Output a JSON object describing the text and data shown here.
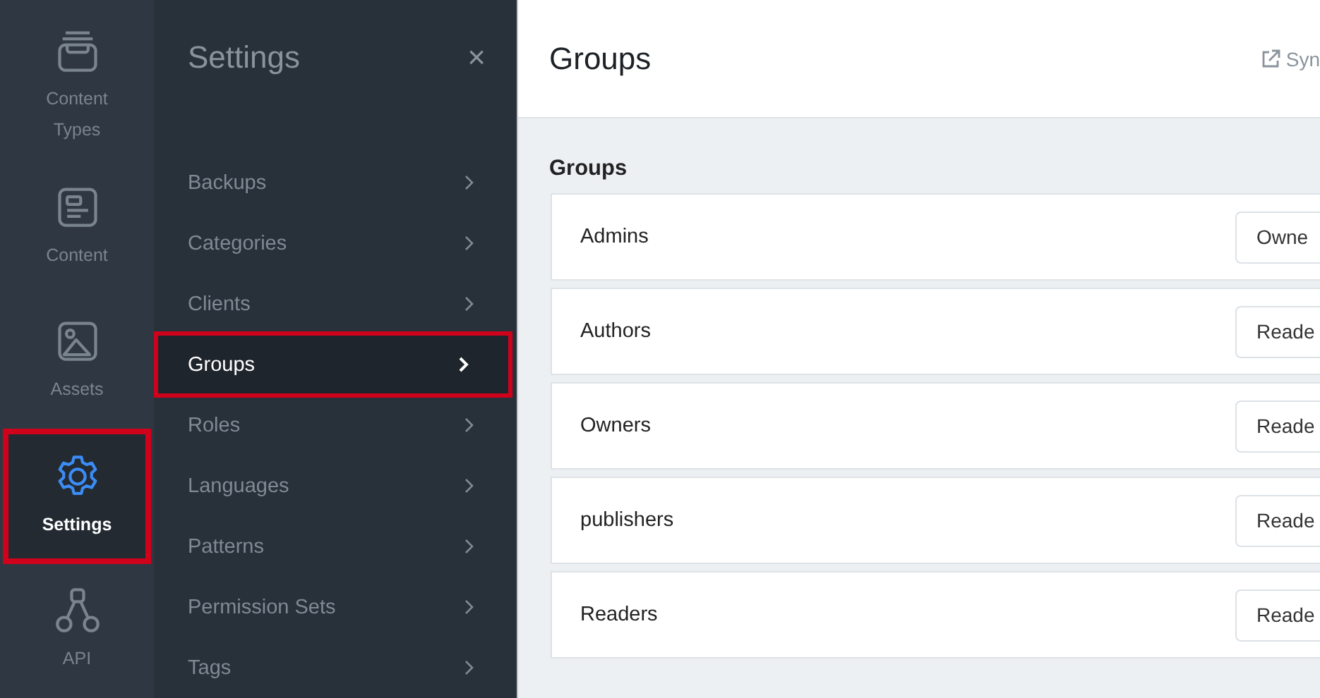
{
  "rail": {
    "items": [
      {
        "kind": "content-types",
        "label": "Content Types",
        "selected": false
      },
      {
        "kind": "content",
        "label": "Content",
        "selected": false
      },
      {
        "kind": "assets",
        "label": "Assets",
        "selected": false
      },
      {
        "kind": "settings",
        "label": "Settings",
        "selected": true
      },
      {
        "kind": "api",
        "label": "API",
        "selected": false
      }
    ]
  },
  "settings_panel": {
    "title": "Settings",
    "close": "×",
    "items": [
      {
        "label": "Backups",
        "selected": false
      },
      {
        "label": "Categories",
        "selected": false
      },
      {
        "label": "Clients",
        "selected": false
      },
      {
        "label": "Groups",
        "selected": true
      },
      {
        "label": "Roles",
        "selected": false
      },
      {
        "label": "Languages",
        "selected": false
      },
      {
        "label": "Patterns",
        "selected": false
      },
      {
        "label": "Permission Sets",
        "selected": false
      },
      {
        "label": "Tags",
        "selected": false
      }
    ]
  },
  "main": {
    "title": "Groups",
    "sync_link": "Syn",
    "section_title": "Groups",
    "groups": [
      {
        "name": "Admins",
        "role": "Owne"
      },
      {
        "name": "Authors",
        "role": "Reade"
      },
      {
        "name": "Owners",
        "role": "Reade"
      },
      {
        "name": "publishers",
        "role": "Reade"
      },
      {
        "name": "Readers",
        "role": "Reade"
      }
    ]
  }
}
